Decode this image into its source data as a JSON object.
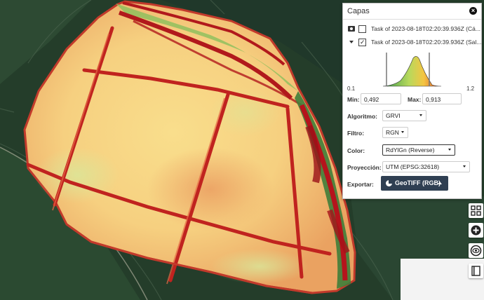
{
  "panel": {
    "title": "Capas",
    "layers": [
      {
        "name": "Task of 2023-08-18T02:20:39.936Z (Cá...",
        "checked": false,
        "icon": "camera-icon"
      },
      {
        "name": "Task of 2023-08-18T02:20:39.936Z (Sal...",
        "checked": true,
        "icon": "expand-icon"
      }
    ],
    "histogram": {
      "min_label": "0.1",
      "max_label": "1.2"
    },
    "min_label": "Min:",
    "min_value": "0,492",
    "max_label": "Max:",
    "max_value": "0,913",
    "algorithm_label": "Algoritmo:",
    "algorithm_value": "GRVI",
    "filter_label": "Filtro:",
    "filter_value": "RGN",
    "color_label": "Color:",
    "color_value": "RdYlGn (Reverse)",
    "projection_label": "Proyección:",
    "projection_value": "UTM (EPSG:32618)",
    "export_label": "Exportar:",
    "export_button": "GeoTIFF (RGB)"
  },
  "toolbar": {
    "icons": [
      "grid-icon",
      "add-icon",
      "eye-icon",
      "book-icon"
    ]
  }
}
